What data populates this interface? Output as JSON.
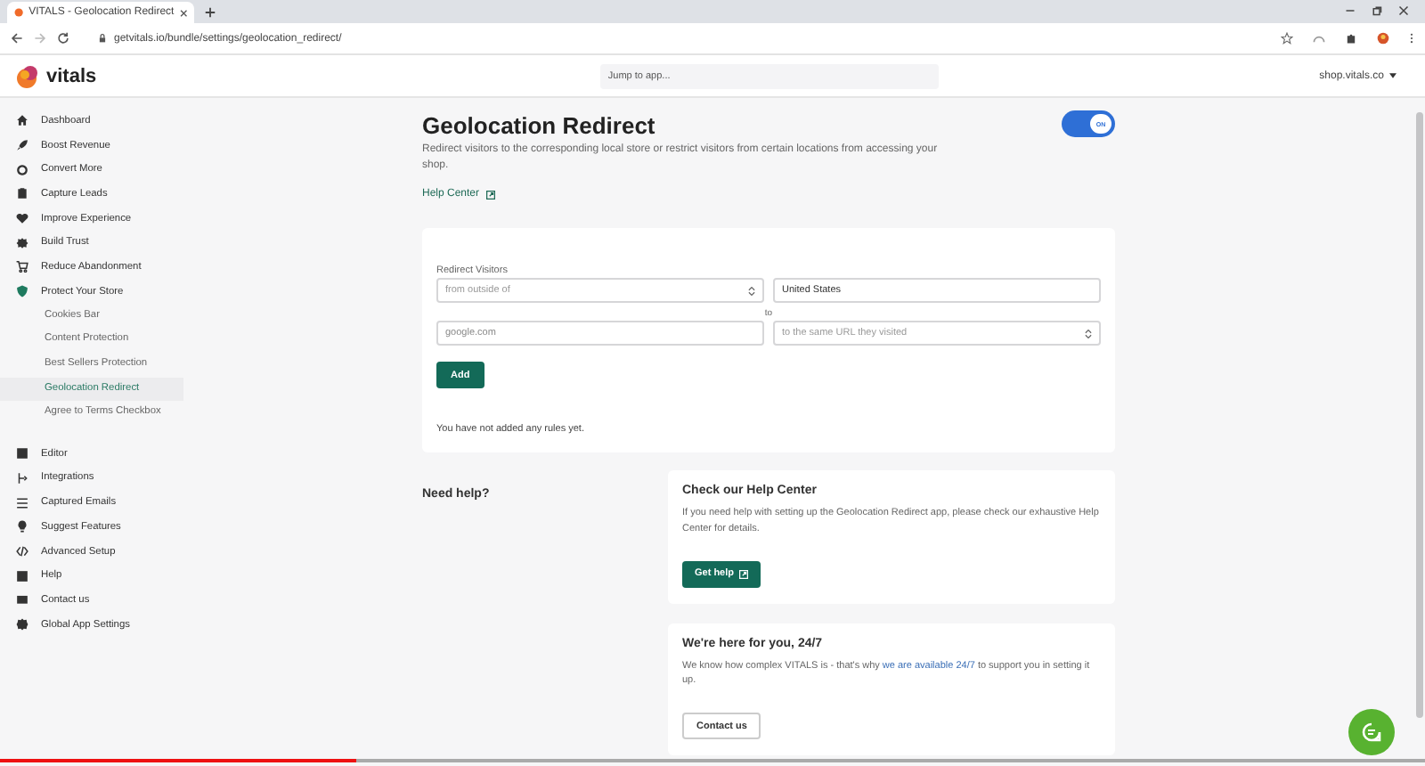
{
  "browser": {
    "tab_title": "VITALS - Geolocation Redirect",
    "url": "getvitals.io/bundle/settings/geolocation_redirect/"
  },
  "header": {
    "logo": "vitals",
    "search_placeholder": "Jump to app...",
    "store": "shop.vitals.co"
  },
  "sidebar": {
    "items": [
      {
        "label": "Dashboard"
      },
      {
        "label": "Boost Revenue"
      },
      {
        "label": "Convert More"
      },
      {
        "label": "Capture Leads"
      },
      {
        "label": "Improve Experience"
      },
      {
        "label": "Build Trust"
      },
      {
        "label": "Reduce Abandonment"
      },
      {
        "label": "Protect Your Store",
        "children": [
          {
            "label": "Cookies Bar",
            "selected": false
          },
          {
            "label": "Content Protection",
            "selected": false
          },
          {
            "label": "Best Sellers Protection",
            "selected": false
          },
          {
            "label": "Geolocation Redirect",
            "selected": true
          },
          {
            "label": "Agree to Terms Checkbox",
            "selected": false
          }
        ]
      }
    ],
    "tools": [
      {
        "label": "Editor"
      },
      {
        "label": "Integrations"
      },
      {
        "label": "Captured Emails"
      },
      {
        "label": "Suggest Features"
      },
      {
        "label": "Advanced Setup"
      },
      {
        "label": "Help"
      },
      {
        "label": "Contact us"
      },
      {
        "label": "Global App Settings"
      }
    ]
  },
  "page": {
    "title": "Geolocation Redirect",
    "enabled": true,
    "toggle_label": "ON",
    "description": "Redirect visitors to the corresponding local store or restrict visitors from certain locations from accessing your shop.",
    "help_link": "Help Center"
  },
  "form": {
    "label": "Redirect Visitors",
    "condition_placeholder": "from outside of",
    "country_value": "United States",
    "connector": "to",
    "url_placeholder": "google.com",
    "target_placeholder": "to the same URL they visited",
    "add_button": "Add",
    "empty_message": "You have not added any rules yet."
  },
  "help": {
    "heading": "Need help?",
    "cards": [
      {
        "title": "Check our Help Center",
        "text": [
          {
            "kind": "text",
            "s": "If you need help with setting up the Geolocation Redirect app, please check our exhaustive Help Center for details."
          }
        ],
        "button": "Get help",
        "primary": true
      },
      {
        "title": "We're here for you, 24/7",
        "text": [
          {
            "kind": "text",
            "s": "We know how complex VITALS is - that's why"
          },
          {
            "kind": "link",
            "s": "we are available 24/7"
          },
          {
            "kind": "text",
            "s": "to support you in setting it up."
          }
        ],
        "button": "Contact us",
        "primary": false
      }
    ]
  },
  "video_progress": {
    "level": 0.25
  }
}
